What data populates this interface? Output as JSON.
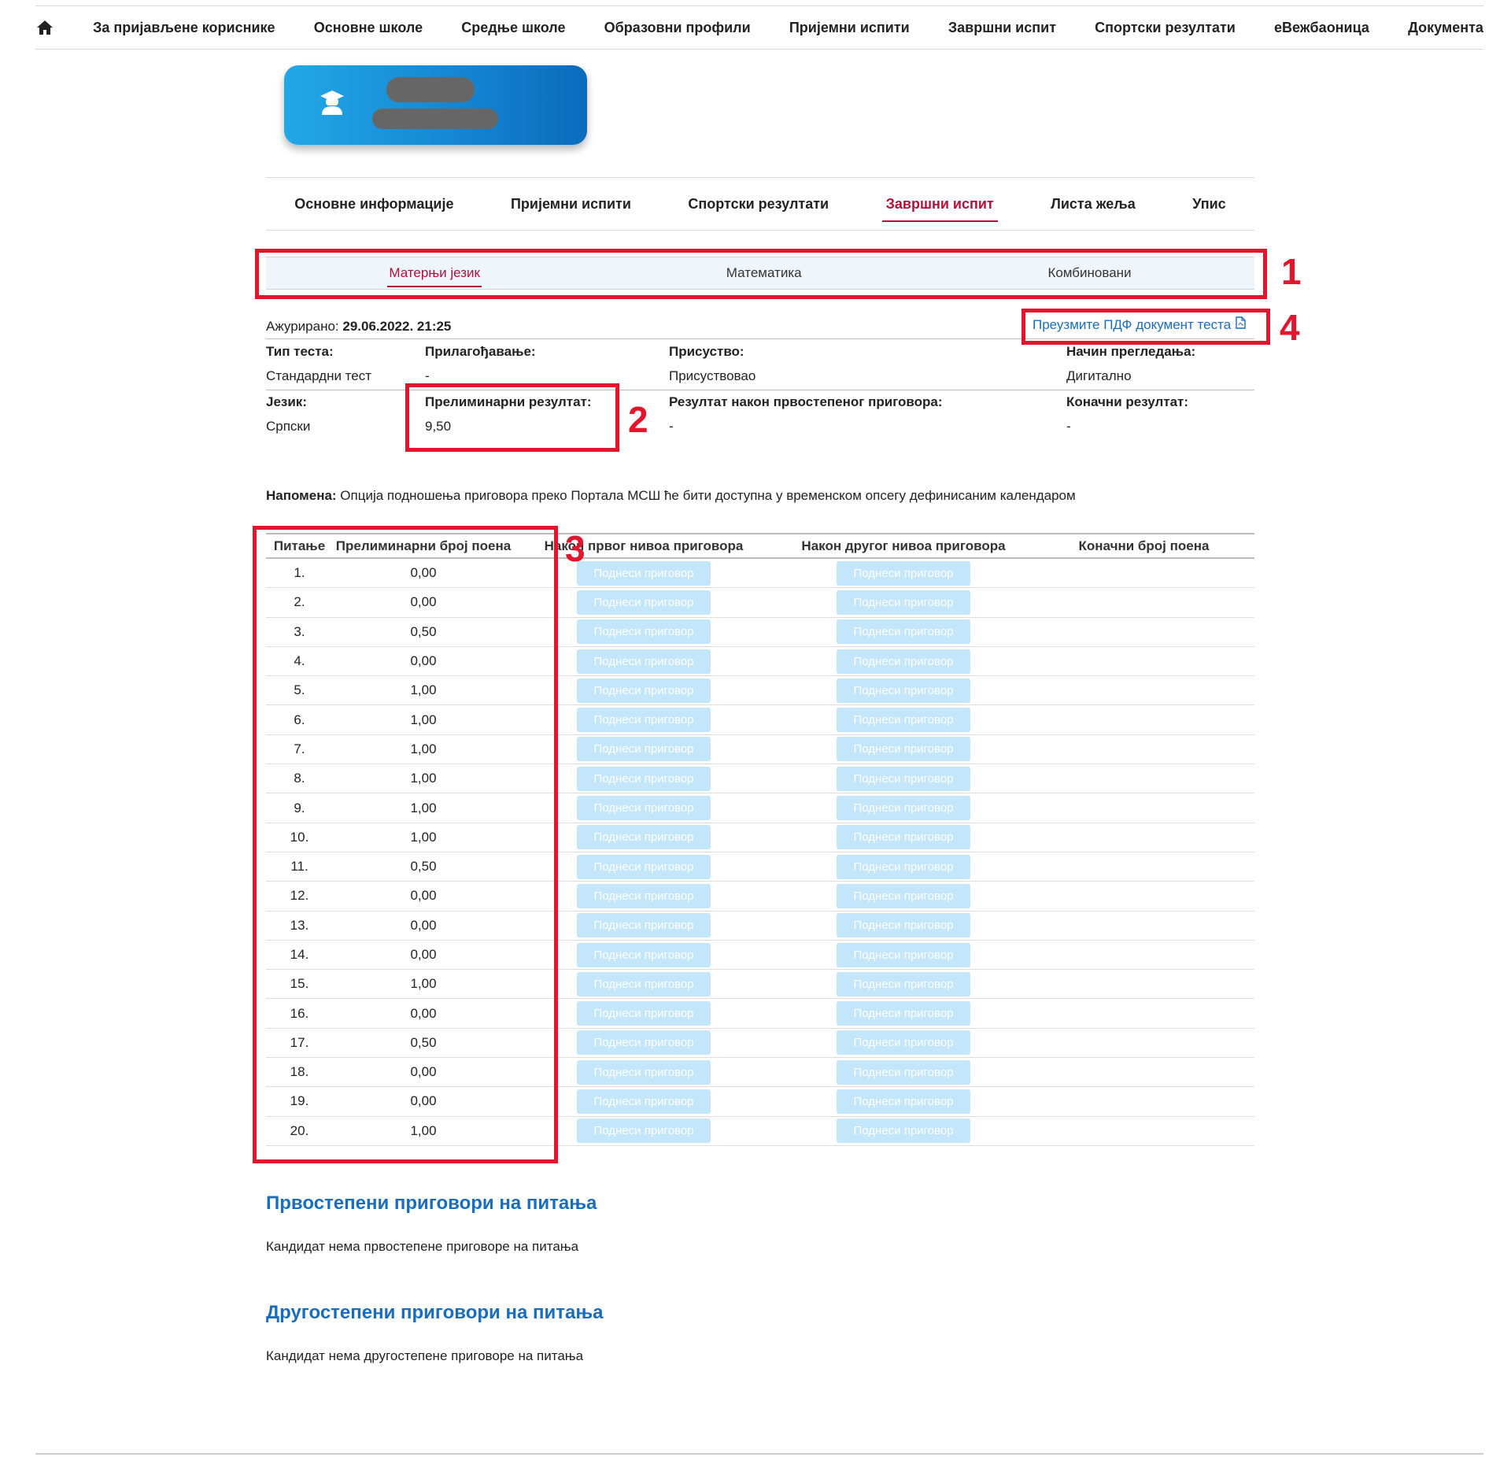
{
  "nav": {
    "items": [
      "За пријављене кориснике",
      "Основне школе",
      "Средње школе",
      "Образовни профили",
      "Пријемни испити",
      "Завршни испит",
      "Спортски резултати",
      "еВежбаоница",
      "Документа"
    ]
  },
  "section_tabs": [
    "Основне информације",
    "Пријемни испити",
    "Спортски резултати",
    "Завршни испит",
    "Листа жеља",
    "Упис"
  ],
  "section_tabs_active": "Завршни испит",
  "subject_tabs": [
    "Матерњи језик",
    "Математика",
    "Комбиновани"
  ],
  "subject_tabs_active": "Матерњи језик",
  "annotations": [
    "1",
    "2",
    "3",
    "4"
  ],
  "info": {
    "updated_label": "Ажурирано:",
    "updated_value": "29.06.2022. 21:25",
    "pdf_link": "Преузмите ПДФ документ теста",
    "test_type_label": "Тип теста:",
    "test_type_value": "Стандардни тест",
    "adjustment_label": "Прилагођавање:",
    "adjustment_value": "-",
    "attendance_label": "Присуство:",
    "attendance_value": "Присуствовао",
    "review_label": "Начин прегледања:",
    "review_value": "Дигитално",
    "language_label": "Језик:",
    "language_value": "Српски",
    "prelim_label": "Прелиминарни резултат:",
    "prelim_value": "9,50",
    "after_appeal_label": "Резултат након првостепеног приговора:",
    "after_appeal_value": "-",
    "final_label": "Коначни резултат:",
    "final_value": "-"
  },
  "note": {
    "label": "Напомена:",
    "text": " Опција подношења приговора преко Портала МСШ ће бити доступна у временском опсегу дефинисаним календаром"
  },
  "table": {
    "headers": [
      "Питање",
      "Прелиминарни број поена",
      "Након првог нивоа приговора",
      "Након другог нивоа приговора",
      "Коначни број поена"
    ],
    "button_label": "Поднеси приговор",
    "rows": [
      {
        "q": "1.",
        "p": "0,00"
      },
      {
        "q": "2.",
        "p": "0,00"
      },
      {
        "q": "3.",
        "p": "0,50"
      },
      {
        "q": "4.",
        "p": "0,00"
      },
      {
        "q": "5.",
        "p": "1,00"
      },
      {
        "q": "6.",
        "p": "1,00"
      },
      {
        "q": "7.",
        "p": "1,00"
      },
      {
        "q": "8.",
        "p": "1,00"
      },
      {
        "q": "9.",
        "p": "1,00"
      },
      {
        "q": "10.",
        "p": "1,00"
      },
      {
        "q": "11.",
        "p": "0,50"
      },
      {
        "q": "12.",
        "p": "0,00"
      },
      {
        "q": "13.",
        "p": "0,00"
      },
      {
        "q": "14.",
        "p": "0,00"
      },
      {
        "q": "15.",
        "p": "1,00"
      },
      {
        "q": "16.",
        "p": "0,00"
      },
      {
        "q": "17.",
        "p": "0,50"
      },
      {
        "q": "18.",
        "p": "0,00"
      },
      {
        "q": "19.",
        "p": "0,00"
      },
      {
        "q": "20.",
        "p": "1,00"
      }
    ]
  },
  "first_appeals": {
    "title": "Првостепени приговори на питања",
    "text": "Кандидат нема првостепене приговоре на питања"
  },
  "second_appeals": {
    "title": "Другостепени приговори на питања",
    "text": "Кандидат нема другостепене приговоре на питања"
  },
  "colors": {
    "accent": "#b0103a",
    "link": "#1a6dbd",
    "annotation": "#e3152c",
    "button_disabled": "#c4e6fa"
  },
  "icons": [
    "home-icon",
    "graduate-icon",
    "pdf-file-icon"
  ]
}
